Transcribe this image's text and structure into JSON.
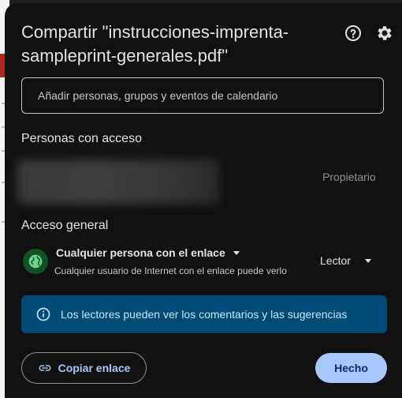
{
  "dialog": {
    "title": "Compartir \"instrucciones-imprenta-sampleprint-generales.pdf\"",
    "help_icon": "help-circle-icon",
    "settings_icon": "gear-icon"
  },
  "add_people": {
    "placeholder": "Añadir personas, grupos y eventos de calendario"
  },
  "people_with_access": {
    "heading": "Personas con acceso",
    "owner": {
      "role": "Propietario"
    }
  },
  "general_access": {
    "heading": "Acceso general",
    "scope_label": "Cualquier persona con el enlace",
    "scope_description": "Cualquier usuario de Internet con el enlace puede verlo",
    "role_label": "Lector",
    "icon": "globe-icon"
  },
  "info_banner": {
    "text": "Los lectores pueden ver los comentarios y las sugerencias",
    "icon": "info-icon"
  },
  "footer": {
    "copy_link_label": "Copiar enlace",
    "done_label": "Hecho"
  },
  "colors": {
    "dialog_bg": "#111111",
    "accent": "#a8c7fa",
    "banner_bg": "#004a77",
    "globe_bg": "#0f5223"
  }
}
